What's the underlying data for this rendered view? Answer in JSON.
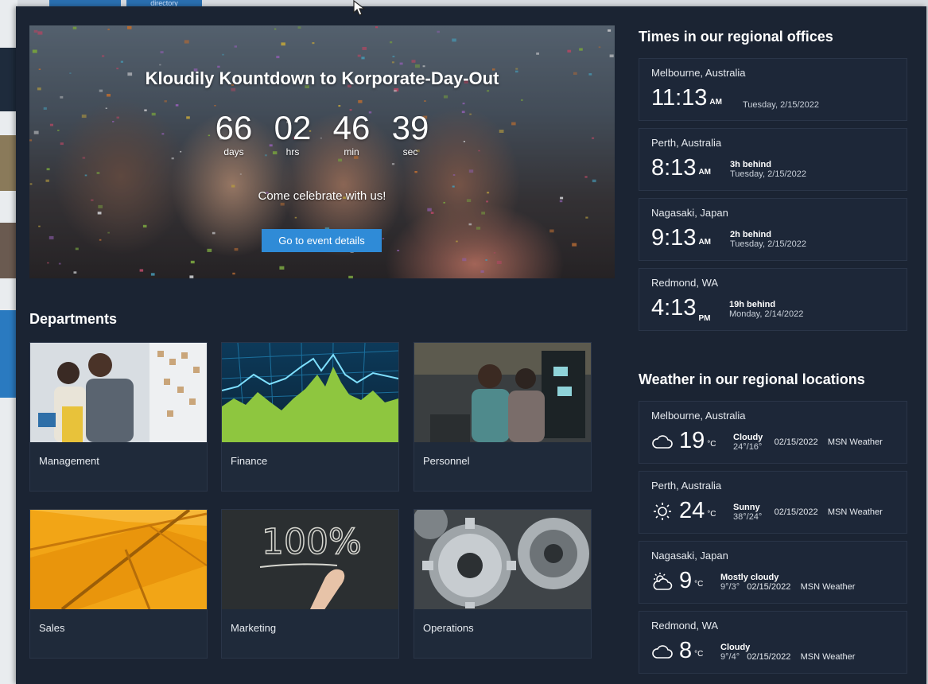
{
  "background_page": {
    "tab_label": "directory"
  },
  "countdown": {
    "title": "Kloudily Kountdown to Korporate-Day-Out",
    "units": [
      {
        "value": "66",
        "label": "days"
      },
      {
        "value": "02",
        "label": "hrs"
      },
      {
        "value": "46",
        "label": "min"
      },
      {
        "value": "39",
        "label": "sec"
      }
    ],
    "subtitle": "Come celebrate with us!",
    "button_label": "Go to event details"
  },
  "departments": {
    "title": "Departments",
    "items": [
      {
        "name": "Management",
        "image": "people-at-whiteboard"
      },
      {
        "name": "Finance",
        "image": "stock-chart"
      },
      {
        "name": "Personnel",
        "image": "people-at-computer"
      },
      {
        "name": "Sales",
        "image": "yellow-umbrella"
      },
      {
        "name": "Marketing",
        "image": "chalkboard-100-percent"
      },
      {
        "name": "Operations",
        "image": "gears"
      }
    ]
  },
  "times": {
    "title": "Times in our regional offices",
    "items": [
      {
        "city": "Melbourne, Australia",
        "time": "11:13",
        "ampm": "AM",
        "offset": "",
        "date": "Tuesday, 2/15/2022"
      },
      {
        "city": "Perth, Australia",
        "time": "8:13",
        "ampm": "AM",
        "offset": "3h behind",
        "date": "Tuesday, 2/15/2022"
      },
      {
        "city": "Nagasaki, Japan",
        "time": "9:13",
        "ampm": "AM",
        "offset": "2h behind",
        "date": "Tuesday, 2/15/2022"
      },
      {
        "city": "Redmond, WA",
        "time": "4:13",
        "ampm": "PM",
        "offset": "19h behind",
        "date": "Monday, 2/14/2022"
      }
    ]
  },
  "weather": {
    "title": "Weather in our regional locations",
    "items": [
      {
        "city": "Melbourne, Australia",
        "icon": "cloud-icon",
        "temp": "19",
        "unit": "°C",
        "condition": "Cloudy",
        "range": "24°/16°",
        "date": "02/15/2022",
        "source": "MSN Weather"
      },
      {
        "city": "Perth, Australia",
        "icon": "sun-icon",
        "temp": "24",
        "unit": "°C",
        "condition": "Sunny",
        "range": "38°/24°",
        "date": "02/15/2022",
        "source": "MSN Weather"
      },
      {
        "city": "Nagasaki, Japan",
        "icon": "partly-cloudy-icon",
        "temp": "9",
        "unit": "°C",
        "condition": "Mostly cloudy",
        "range": "9°/3°",
        "date": "02/15/2022",
        "source": "MSN Weather"
      },
      {
        "city": "Redmond, WA",
        "icon": "cloud-icon",
        "temp": "8",
        "unit": "°C",
        "condition": "Cloudy",
        "range": "9°/4°",
        "date": "02/15/2022",
        "source": "MSN Weather"
      }
    ]
  }
}
